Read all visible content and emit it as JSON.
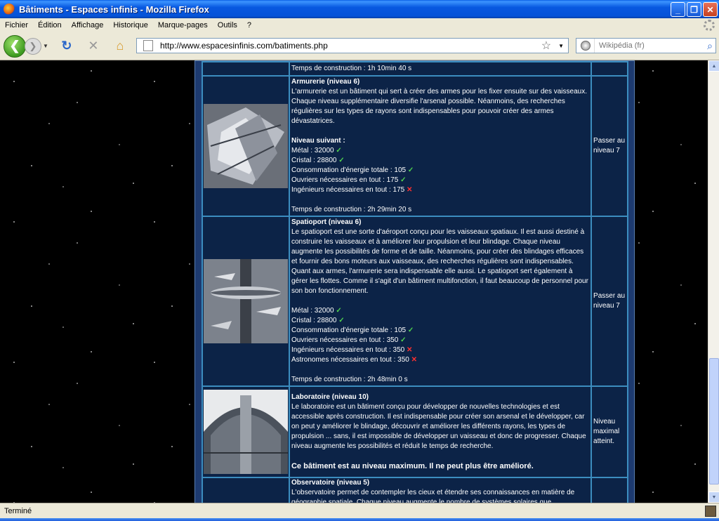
{
  "window": {
    "title": "Bâtiments - Espaces infinis - Mozilla Firefox"
  },
  "menu": [
    "Fichier",
    "Édition",
    "Affichage",
    "Historique",
    "Marque-pages",
    "Outils",
    "?"
  ],
  "nav": {
    "url": "http://www.espacesinfinis.com/batiments.php",
    "search_placeholder": "Wikipédia (fr)"
  },
  "status": {
    "text": "Terminé"
  },
  "buildings": {
    "prev_time": "Temps de construction : 1h 10min 40 s",
    "armurerie": {
      "name": "Armurerie (niveau 6)",
      "desc": "L'armurerie est un bâtiment qui sert à créer des armes pour les fixer ensuite sur des vaisseaux. Chaque niveau supplémentaire diversifie l'arsenal possible. Néanmoins, des recherches régulières sur les types de rayons sont indispensables pour pouvoir créer des armes dévastatrices.",
      "next_label": "Niveau suivant :",
      "metal": "Métal : 32000",
      "cristal": "Cristal : 28800",
      "energie": "Consommation d'énergie totale : 105",
      "ouvriers": "Ouvriers nécessaires en tout : 175",
      "ingenieurs": "Ingénieurs nécessaires en tout : 175",
      "time": "Temps de construction : 2h 29min 20 s",
      "action": "Passer au niveau 7"
    },
    "spatioport": {
      "name": "Spatioport (niveau 6)",
      "desc": "Le spatioport est une sorte d'aéroport conçu pour les vaisseaux spatiaux. Il est aussi destiné à construire les vaisseaux et à améliorer leur propulsion et leur blindage. Chaque niveau augmente les possibilités de forme et de taille. Néanmoins, pour créer des blindages efficaces et fournir des bons moteurs aux vaisseaux, des recherches régulières sont indispensables. Quant aux armes, l'armurerie sera indispensable elle aussi. Le spatioport sert également à gérer les flottes. Comme il s'agit d'un bâtiment multifonction, il faut beaucoup de personnel pour son bon fonctionnement.",
      "metal": "Métal : 32000",
      "cristal": "Cristal : 28800",
      "energie": "Consommation d'énergie totale : 105",
      "ouvriers": "Ouvriers nécessaires en tout : 350",
      "ingenieurs": "Ingénieurs nécessaires en tout : 350",
      "astronomes": "Astronomes nécessaires en tout : 350",
      "time": "Temps de construction : 2h 48min 0 s",
      "action": "Passer au niveau 7"
    },
    "laboratoire": {
      "name": "Laboratoire (niveau 10)",
      "desc": "Le laboratoire est un bâtiment conçu pour développer de nouvelles technologies et est accessible après construction. Il est indispensable pour créer son arsenal et le développer, car on peut y améliorer le blindage, découvrir et améliorer les différents rayons, les types de propulsion ... sans, il est impossible de développer un vaisseau et donc de progresser. Chaque niveau augmente les possibilités et réduit le temps de recherche.",
      "max_msg": "Ce bâtiment est au niveau maximum. Il ne peut plus être amélioré.",
      "action": "Niveau maximal atteint."
    },
    "observatoire": {
      "name": "Observatoire (niveau 5)",
      "desc": "L'observatoire permet de contempler les cieux et étendre ses connaissances en matière de géographie spatiale. Chaque niveau augmente le nombre de systèmes solaires que"
    }
  }
}
